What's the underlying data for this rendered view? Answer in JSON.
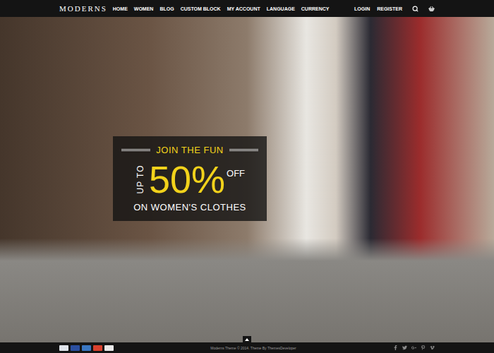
{
  "logo": "MODERNS",
  "nav": {
    "items": [
      "HOME",
      "WOMEN",
      "BLOG",
      "CUSTOM BLOCK",
      "MY ACCOUNT",
      "LANGUAGE",
      "CURRENCY"
    ],
    "account": [
      "LOGIN",
      "REGISTER"
    ]
  },
  "promo": {
    "kicker": "JOIN THE FUN",
    "prefix": "UP TO",
    "amount": "50%",
    "suffix": "OFF",
    "caption": "ON WOMEN'S CLOTHES"
  },
  "footer": {
    "copyright": "Moderns Theme © 2014. Theme By ThemesDeveloper",
    "payments": [
      {
        "color": "#dfe3ea"
      },
      {
        "color": "#2b4fa0"
      },
      {
        "color": "#3a77c2"
      },
      {
        "color": "#d9412e"
      },
      {
        "color": "#e9e9e9"
      }
    ]
  }
}
